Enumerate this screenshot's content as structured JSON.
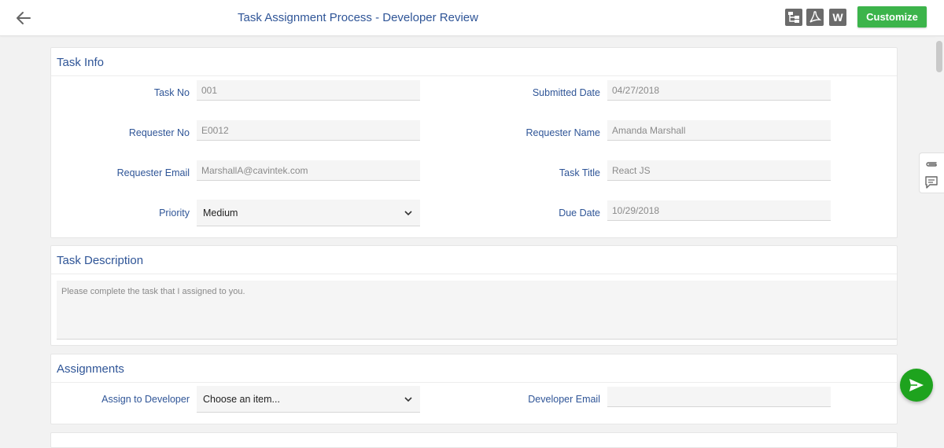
{
  "header": {
    "title": "Task Assignment Process - Developer Review",
    "tools": [
      "hierarchy-icon",
      "pdf-icon",
      "word-icon"
    ],
    "word_label": "W",
    "customize_label": "Customize"
  },
  "task_info": {
    "title": "Task Info",
    "task_no": {
      "label": "Task No",
      "value": "001"
    },
    "submitted_date": {
      "label": "Submitted Date",
      "value": "04/27/2018"
    },
    "requester_no": {
      "label": "Requester No",
      "value": "E0012"
    },
    "requester_name": {
      "label": "Requester Name",
      "value": "Amanda Marshall"
    },
    "requester_email": {
      "label": "Requester Email",
      "value": "MarshallA@cavintek.com"
    },
    "task_title": {
      "label": "Task Title",
      "value": "React JS"
    },
    "priority": {
      "label": "Priority",
      "value": "Medium"
    },
    "due_date": {
      "label": "Due Date",
      "value": "10/29/2018"
    }
  },
  "task_description": {
    "title": "Task Description",
    "value": "Please complete the task that I assigned to you."
  },
  "assignments": {
    "title": "Assignments",
    "assign_to_developer": {
      "label": "Assign to Developer",
      "value": "Choose an item..."
    },
    "developer_email": {
      "label": "Developer Email",
      "value": ""
    }
  },
  "colors": {
    "accent": "#2f5597",
    "customize": "#3cb44b",
    "send": "#1ea31e"
  }
}
